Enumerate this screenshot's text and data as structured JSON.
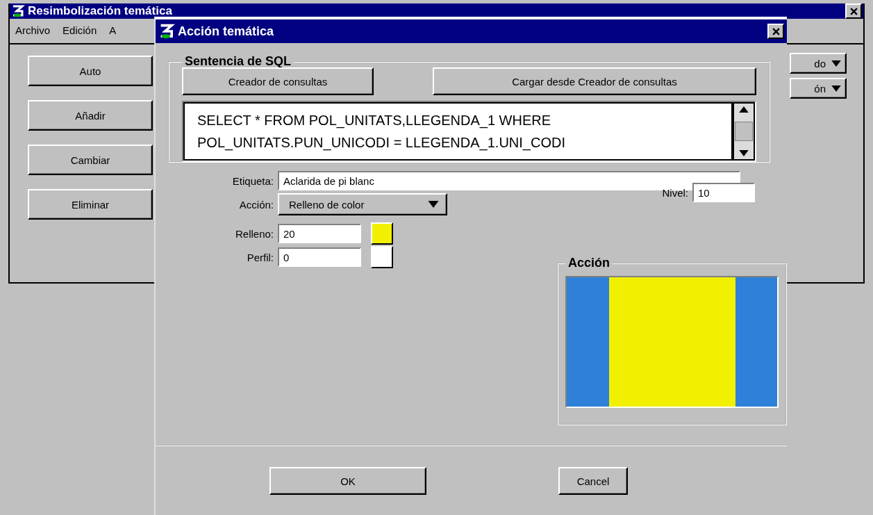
{
  "back_window": {
    "title": "Resimbolización temática",
    "menu": [
      "Archivo",
      "Edición",
      "A"
    ],
    "buttons": [
      "Auto",
      "Añadir",
      "Cambiar",
      "Eliminar"
    ],
    "dropdowns": [
      "do",
      "ón"
    ]
  },
  "dialog": {
    "title": "Acción temática",
    "sql_group": {
      "title": "Sentencia de SQL",
      "buttons": [
        "Creador de consultas",
        "Cargar desde Creador de consultas"
      ],
      "query_lines": [
        "SELECT * FROM POL_UNITATS,LLEGENDA_1 WHERE",
        "POL_UNITATS.PUN_UNICODI = LLEGENDA_1.UNI_CODI"
      ]
    },
    "etiqueta": {
      "label": "Etiqueta:",
      "value": "Aclarida de pi blanc"
    },
    "accion": {
      "label": "Acción:",
      "value": "Relleno de color"
    },
    "nivel": {
      "label": "Nivel:",
      "value": "10"
    },
    "relleno": {
      "label": "Relleno:",
      "value": "20",
      "color": "#f0f000"
    },
    "perfil": {
      "label": "Perfil:",
      "value": "0",
      "color": "#ffffff"
    },
    "preview": {
      "title": "Acción"
    },
    "buttons": [
      "OK",
      "Cancel"
    ]
  }
}
